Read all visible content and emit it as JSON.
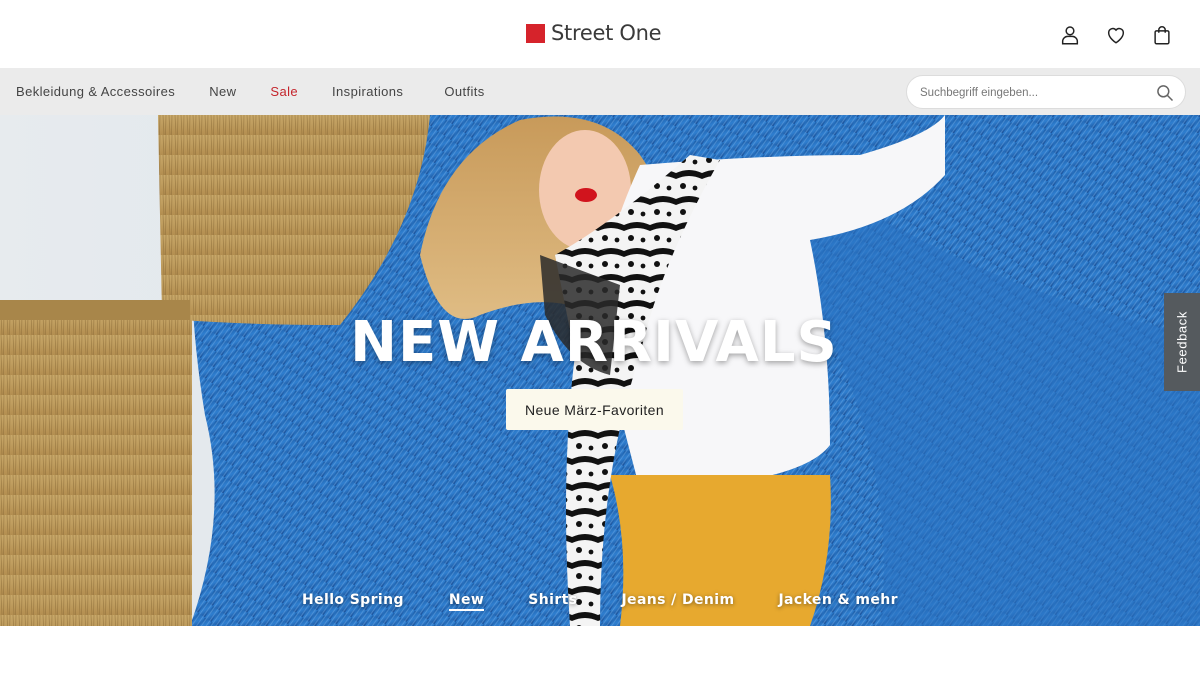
{
  "brand": {
    "name": "Street One",
    "accent_color": "#d6232b"
  },
  "header_icons": [
    {
      "name": "user-icon"
    },
    {
      "name": "heart-icon"
    },
    {
      "name": "shopping-bag-icon"
    }
  ],
  "nav": {
    "items": [
      {
        "label": "Bekleidung & Accessoires"
      },
      {
        "label": "New"
      },
      {
        "label": "Sale",
        "color": "#c4252c"
      },
      {
        "label": "Inspirations"
      },
      {
        "label": "Outfits"
      }
    ],
    "search": {
      "placeholder": "Suchbegriff eingeben...",
      "value": ""
    }
  },
  "hero": {
    "title": "NEW ARRIVALS",
    "cta_label": "Neue März-Favoriten",
    "links": [
      {
        "label": "Hello Spring"
      },
      {
        "label": "New",
        "active": true
      },
      {
        "label": "Shirts"
      },
      {
        "label": "Jeans / Denim"
      },
      {
        "label": "Jacken & mehr"
      }
    ]
  },
  "feedback": {
    "label": "Feedback"
  }
}
